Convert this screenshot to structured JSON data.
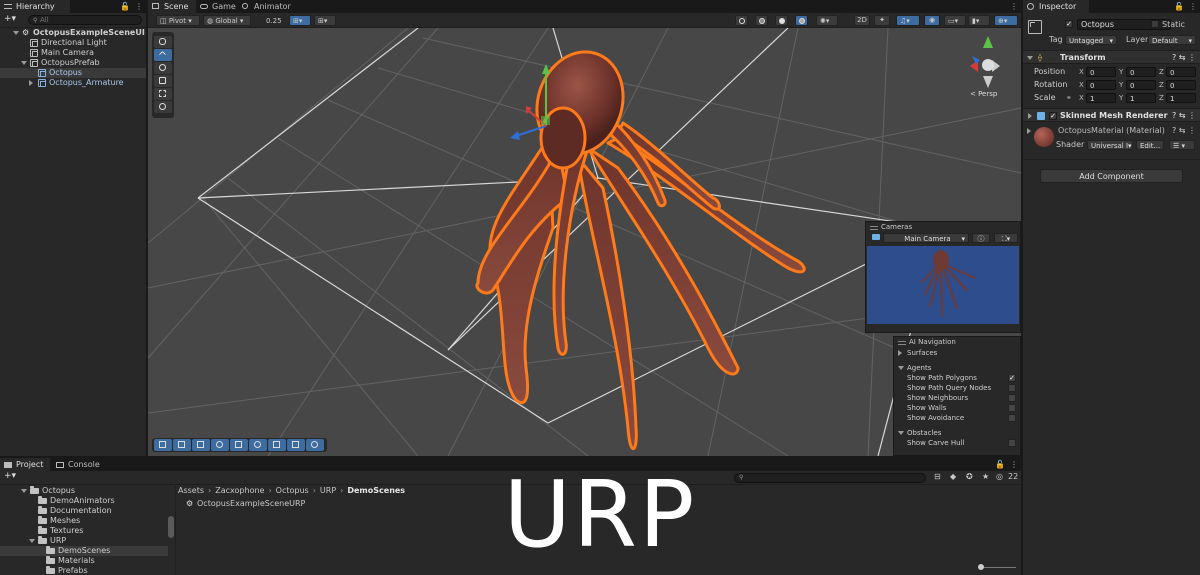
{
  "hierarchy": {
    "tab_label": "Hierarchy",
    "add_label": "+▾",
    "search_placeholder": "All",
    "rows": [
      {
        "label": "OctopusExampleSceneUI",
        "indent": 0,
        "kind": "scene",
        "expanded": true,
        "selected": false
      },
      {
        "label": "Directional Light",
        "indent": 1,
        "kind": "object",
        "expanded": null,
        "selected": false
      },
      {
        "label": "Main Camera",
        "indent": 1,
        "kind": "object",
        "expanded": null,
        "selected": false
      },
      {
        "label": "OctopusPrefab",
        "indent": 1,
        "kind": "object",
        "expanded": true,
        "selected": false
      },
      {
        "label": "Octopus",
        "indent": 2,
        "kind": "prefab",
        "expanded": null,
        "selected": true
      },
      {
        "label": "Octopus_Armature",
        "indent": 2,
        "kind": "prefab",
        "expanded": false,
        "selected": false
      }
    ]
  },
  "scene": {
    "tabs": [
      {
        "label": "Scene",
        "active": true
      },
      {
        "label": "Game",
        "active": false
      },
      {
        "label": "Animator",
        "active": false
      }
    ],
    "pivot_label": "Pivot",
    "global_label": "Global",
    "snap_value": "0.25",
    "persp_label": "< Persp",
    "cameras_overlay": {
      "title": "Cameras",
      "camera_name": "Main Camera"
    },
    "ai_navigation": {
      "title": "AI Navigation",
      "sections": [
        {
          "label": "Surfaces",
          "expanded": false,
          "items": []
        },
        {
          "label": "Agents",
          "expanded": true,
          "items": [
            {
              "label": "Show Path Polygons",
              "checked": true
            },
            {
              "label": "Show Path Query Nodes",
              "checked": false
            },
            {
              "label": "Show Neighbours",
              "checked": false
            },
            {
              "label": "Show Walls",
              "checked": false
            },
            {
              "label": "Show Avoidance",
              "checked": false
            }
          ]
        },
        {
          "label": "Obstacles",
          "expanded": true,
          "items": [
            {
              "label": "Show Carve Hull",
              "checked": false
            }
          ]
        }
      ]
    }
  },
  "inspector": {
    "tab_label": "Inspector",
    "object_name": "Octopus",
    "static_label": "Static",
    "tag_label": "Tag",
    "tag_value": "Untagged",
    "layer_label": "Layer",
    "layer_value": "Default",
    "transform": {
      "title": "Transform",
      "position_label": "Position",
      "rotation_label": "Rotation",
      "scale_label": "Scale",
      "position": {
        "x": "0",
        "y": "0",
        "z": "0"
      },
      "rotation": {
        "x": "0",
        "y": "0",
        "z": "0"
      },
      "scale": {
        "x": "1",
        "y": "1",
        "z": "1"
      }
    },
    "skinned_mesh_renderer": {
      "title": "Skinned Mesh Renderer"
    },
    "material": {
      "name": "OctopusMaterial (Material)",
      "shader_label": "Shader",
      "shader_value": "Universal I▾",
      "edit_label": "Edit..."
    },
    "add_component_label": "Add Component"
  },
  "project": {
    "tabs": [
      {
        "label": "Project",
        "active": true
      },
      {
        "label": "Console",
        "active": false
      }
    ],
    "add_label": "+▾",
    "breadcrumb": [
      "Assets",
      "Zacxophone",
      "Octopus",
      "URP",
      "DemoScenes"
    ],
    "visible_count": "22",
    "tree": [
      {
        "label": "Octopus",
        "indent": 0,
        "expanded": true,
        "selected": false
      },
      {
        "label": "DemoAnimators",
        "indent": 1,
        "expanded": null,
        "selected": false
      },
      {
        "label": "Documentation",
        "indent": 1,
        "expanded": null,
        "selected": false
      },
      {
        "label": "Meshes",
        "indent": 1,
        "expanded": null,
        "selected": false
      },
      {
        "label": "Textures",
        "indent": 1,
        "expanded": null,
        "selected": false
      },
      {
        "label": "URP",
        "indent": 1,
        "expanded": true,
        "selected": false
      },
      {
        "label": "DemoScenes",
        "indent": 2,
        "expanded": null,
        "selected": true
      },
      {
        "label": "Materials",
        "indent": 2,
        "expanded": null,
        "selected": false
      },
      {
        "label": "Prefabs",
        "indent": 2,
        "expanded": null,
        "selected": false
      }
    ],
    "assets": [
      {
        "label": "OctopusExampleSceneURP"
      }
    ]
  },
  "banner_text": "URP",
  "colors": {
    "selection": "#3d6ca0",
    "outline": "#ff7a1a",
    "octopus": "#7a3a30",
    "camera_bg": "#2e4d8c"
  }
}
